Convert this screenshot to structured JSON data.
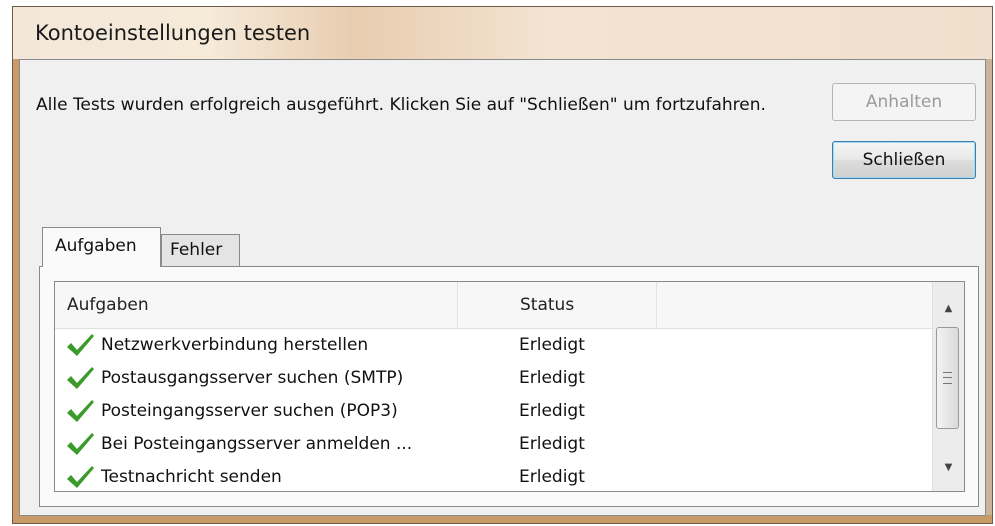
{
  "window": {
    "title": "Kontoeinstellungen testen"
  },
  "message": "Alle Tests wurden erfolgreich ausgeführt. Klicken Sie auf \"Schließen\" um fortzufahren.",
  "buttons": {
    "stop": "Anhalten",
    "close": "Schließen"
  },
  "tabs": [
    {
      "label": "Aufgaben",
      "active": true
    },
    {
      "label": "Fehler",
      "active": false
    }
  ],
  "table": {
    "columns": [
      "Aufgaben",
      "Status"
    ],
    "rows": [
      {
        "task": "Netzwerkverbindung herstellen",
        "status": "Erledigt",
        "icon": "checkmark-icon"
      },
      {
        "task": "Postausgangsserver suchen (SMTP)",
        "status": "Erledigt",
        "icon": "checkmark-icon"
      },
      {
        "task": "Posteingangsserver suchen (POP3)",
        "status": "Erledigt",
        "icon": "checkmark-icon"
      },
      {
        "task": "Bei Posteingangsserver anmelden ...",
        "status": "Erledigt",
        "icon": "checkmark-icon"
      },
      {
        "task": "Testnachricht senden",
        "status": "Erledigt",
        "icon": "checkmark-icon"
      }
    ]
  },
  "colors": {
    "check": "#3a9a2a",
    "disabled_text": "#9a9a9a",
    "primary_border": "#3c7fb1"
  }
}
